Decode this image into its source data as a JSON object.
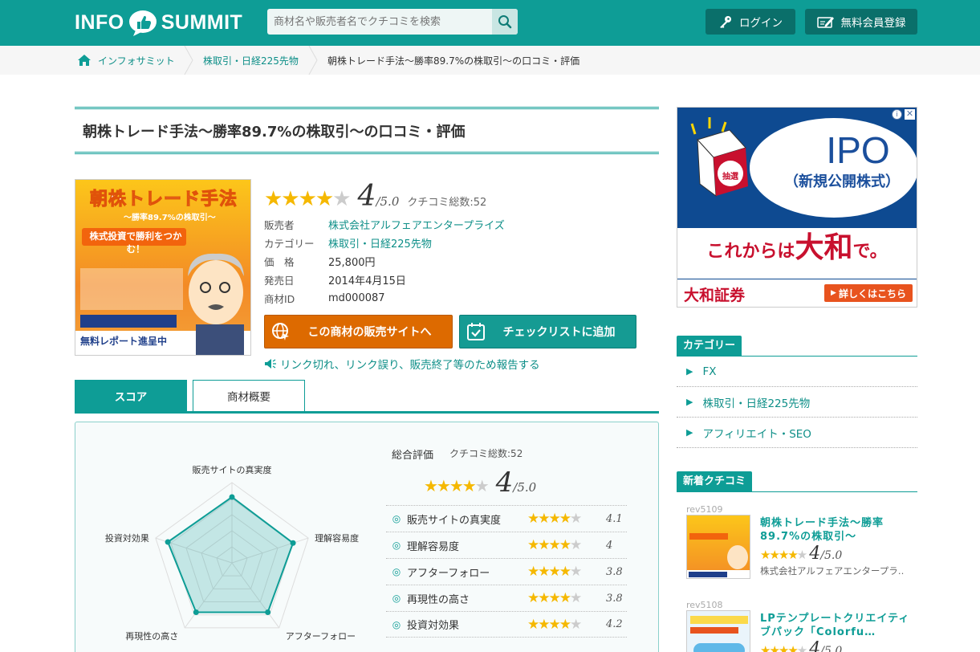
{
  "header": {
    "logo_left": "INFO",
    "logo_right": "SUMMIT",
    "search_placeholder": "商材名や販売者名でクチコミを検索",
    "login_label": "ログイン",
    "register_label": "無料会員登録",
    "brand_color": "#0e9d96"
  },
  "breadcrumb": {
    "home": "インフォサミット",
    "category": "株取引・日経225先物",
    "current": "朝株トレード手法～勝率89.7%の株取引～の口コミ・評価"
  },
  "product": {
    "title": "朝株トレード手法～勝率89.7%の株取引～の口コミ・評価",
    "rating": "4",
    "rating_max": "/5.0",
    "rating_stars": 4,
    "review_count_label": "クチコミ総数:52",
    "image_text": {
      "title": "朝株トレード手法",
      "subtitle": "～勝率89.7%の株取引～",
      "tagline": "株式投資で勝利をつかむ！",
      "footer": "無料レポート進呈中"
    },
    "info": [
      {
        "label": "販売者",
        "value": "株式会社アルフェアエンタープライズ",
        "link": true
      },
      {
        "label": "カテゴリー",
        "value": "株取引・日経225先物",
        "link": true
      },
      {
        "label": "価　格",
        "value": "25,800円",
        "link": false
      },
      {
        "label": "発売日",
        "value": "2014年4月15日",
        "link": false
      },
      {
        "label": "商材ID",
        "value": "md000087",
        "link": false
      }
    ],
    "buttons": {
      "sales_site": "この商材の販売サイトへ",
      "checklist": "チェックリストに追加"
    },
    "report_link": "リンク切れ、リンク誤り、販売終了等のため報告する"
  },
  "tabs": [
    {
      "label": "スコア",
      "active": true
    },
    {
      "label": "商材概要",
      "active": false
    }
  ],
  "score": {
    "summary_label": "総合評価",
    "summary_count": "クチコミ総数:52",
    "rating": "4",
    "rating_max": "/5.0",
    "items": [
      {
        "name": "販売サイトの真実度",
        "value": 4.1,
        "display": "4.1"
      },
      {
        "name": "理解容易度",
        "value": 4,
        "display": "4"
      },
      {
        "name": "アフターフォロー",
        "value": 3.8,
        "display": "3.8"
      },
      {
        "name": "再現性の高さ",
        "value": 3.8,
        "display": "3.8"
      },
      {
        "name": "投資対効果",
        "value": 4.2,
        "display": "4.2"
      }
    ]
  },
  "chart_data": {
    "type": "radar",
    "categories": [
      "販売サイトの真実度",
      "理解容易度",
      "アフターフォロー",
      "再現性の高さ",
      "投資対効果"
    ],
    "values": [
      4.1,
      4,
      3.8,
      3.8,
      4.2
    ],
    "rlim": [
      0,
      5
    ]
  },
  "ad": {
    "headline": "IPO",
    "subline": "（新規公開株式）",
    "ticket": "抽選",
    "tagline_pre": "これからは",
    "tagline_brand": "大和",
    "tagline_post": "で。",
    "company": "大和証券",
    "cta": "詳しくはこちら"
  },
  "sidebar": {
    "category_heading": "カテゴリー",
    "categories": [
      "FX",
      "株取引・日経225先物",
      "アフィリエイト・SEO"
    ],
    "new_reviews_heading": "新着クチコミ",
    "reviews": [
      {
        "id": "rev5109",
        "title": "朝株トレード手法～勝率89.7%の株取引～",
        "rating": "4",
        "rating_max": "/5.0",
        "seller": "株式会社アルフェアエンタープラ…"
      },
      {
        "id": "rev5108",
        "title": "LPテンプレートクリエイティブパック「Colorfu…",
        "rating": "4",
        "rating_max": "/5.0",
        "seller": ""
      }
    ]
  }
}
